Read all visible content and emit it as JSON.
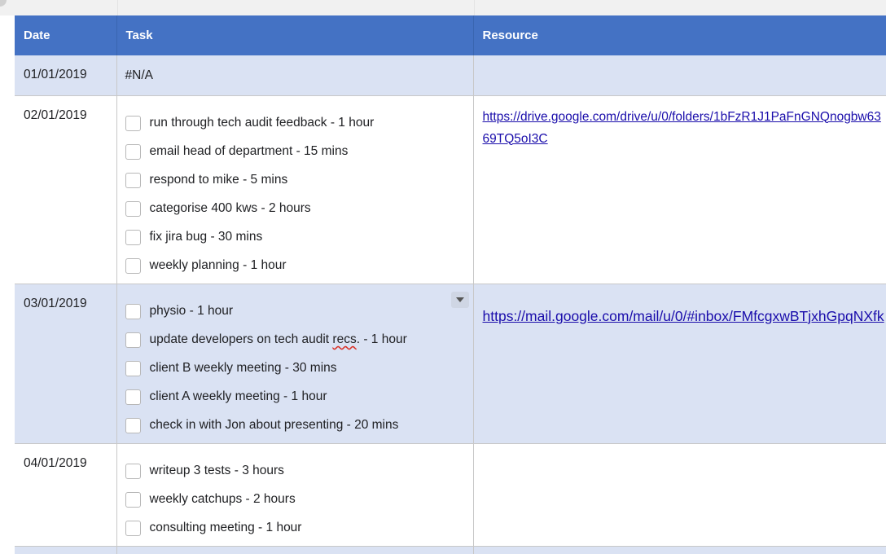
{
  "headers": {
    "date": "Date",
    "task": "Task",
    "resource": "Resource"
  },
  "rows": [
    {
      "date": "01/01/2019",
      "na": "#N/A"
    },
    {
      "date": "02/01/2019",
      "tasks": [
        "run through tech audit feedback - 1 hour",
        "email head of department - 15 mins",
        "respond to mike - 5 mins",
        "categorise 400 kws - 2 hours",
        "fix jira bug - 30 mins",
        "weekly planning - 1 hour"
      ],
      "resource": "https://drive.google.com/drive/u/0/folders/1bFzR1J1PaFnGNQnogbw6369TQ5oI3C"
    },
    {
      "date": "03/01/2019",
      "tasks_pre": "update developers on tech audit ",
      "tasks_flag": "recs",
      "tasks_post": ". - 1 hour",
      "tasks": [
        "physio - 1 hour",
        "update developers on tech audit recs. - 1 hour",
        "client B weekly meeting - 30 mins",
        "client A weekly meeting - 1 hour",
        "check in with Jon about presenting - 20 mins"
      ],
      "resource": "https://mail.google.com/mail/u/0/#inbox/FMfcgxwBTjxhGpqNXfk"
    },
    {
      "date": "04/01/2019",
      "tasks": [
        "writeup 3 tests - 3 hours",
        "weekly catchups - 2 hours",
        "consulting meeting - 1 hour"
      ]
    }
  ],
  "icons": {
    "checkbox": "checkbox-icon",
    "dropdown": "chevron-down-icon"
  },
  "colors": {
    "header": "#4472c4",
    "band": "#dae2f3",
    "link": "#1a0dab"
  }
}
